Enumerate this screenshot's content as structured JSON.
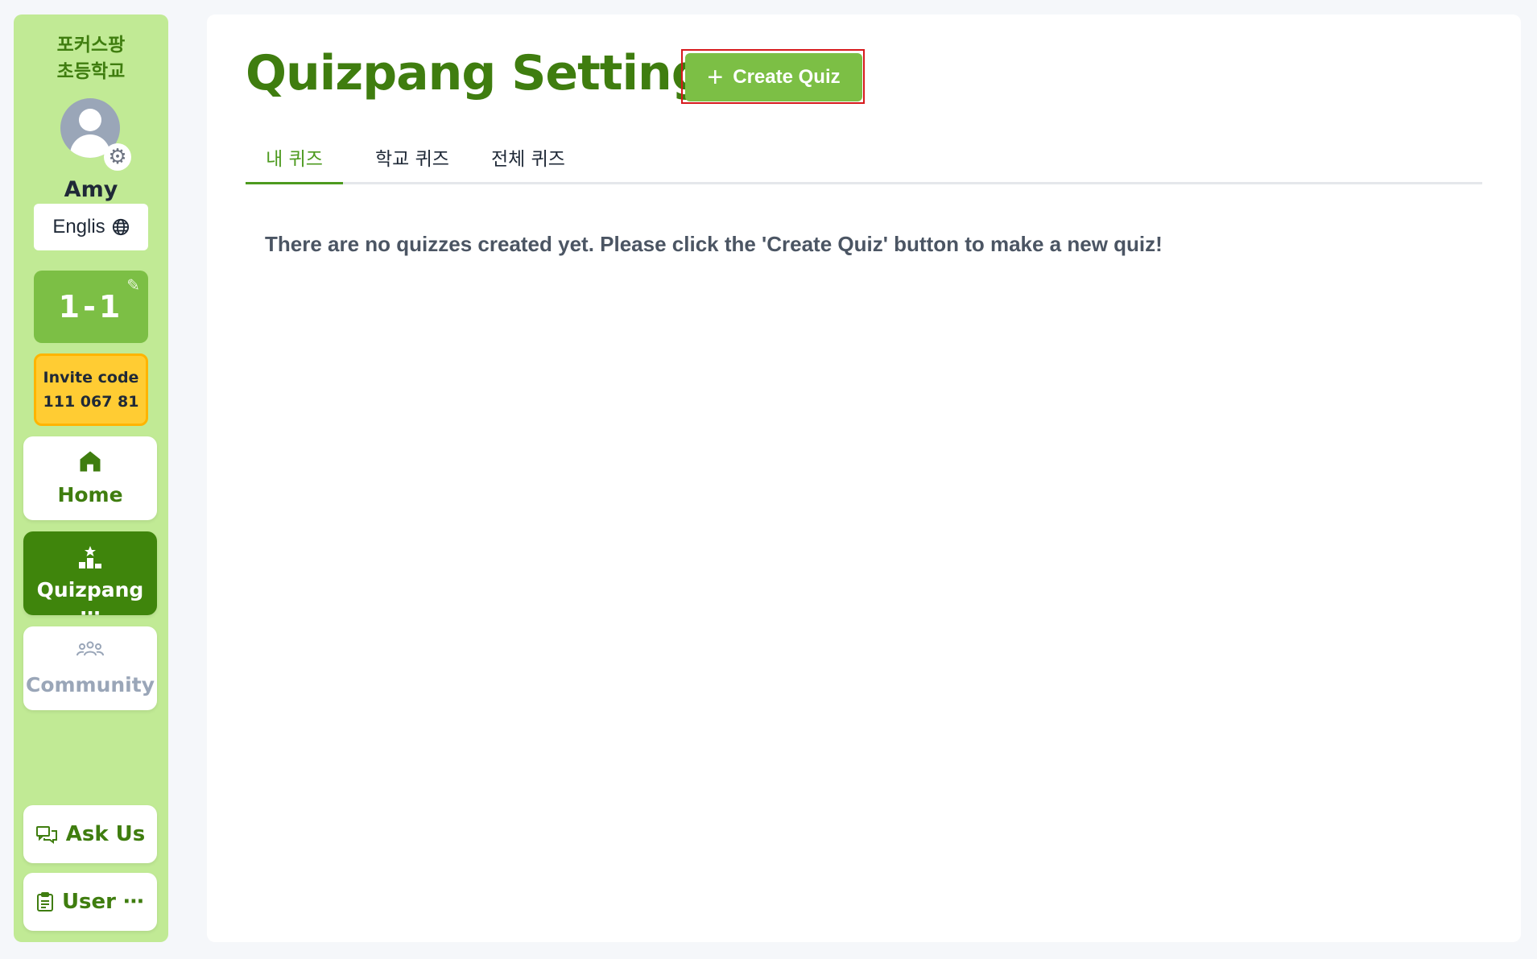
{
  "sidebar": {
    "school_name_line1": "포커스팡",
    "school_name_line2": "초등학교",
    "user_name": "Amy",
    "language_label": "Englis",
    "class_label": "1-1",
    "invite_label": "Invite code",
    "invite_code": "111 067 81",
    "nav": {
      "home": "Home",
      "quizpang": "Quizpang ⋯",
      "community": "Community",
      "ask_us": "Ask Us",
      "user": "User ⋯"
    }
  },
  "main": {
    "title": "Quizpang Settings",
    "create_button": "Create Quiz",
    "tabs": [
      "내 퀴즈",
      "학교 퀴즈",
      "전체 퀴즈"
    ],
    "active_tab_index": 0,
    "empty_message": "There are no quizzes created yet. Please click the 'Create Quiz' button to make a new quiz!"
  },
  "colors": {
    "sidebar_bg": "#c1ea95",
    "brand_green": "#3f7d0f",
    "button_green": "#7cbf45",
    "active_nav": "#3f850c",
    "invite_yellow": "#ffcc33",
    "highlight_red": "#d7191c"
  },
  "icons": [
    "gear-icon",
    "globe-icon",
    "pencil-icon",
    "home-icon",
    "podium-icon",
    "community-icon",
    "chat-icon",
    "clipboard-icon",
    "plus-icon"
  ]
}
